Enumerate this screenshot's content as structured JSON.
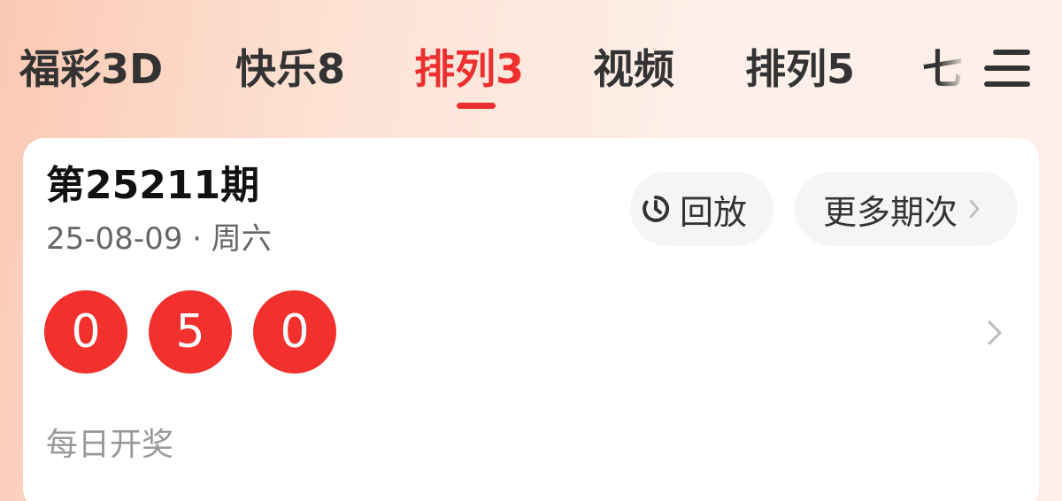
{
  "tabs": [
    {
      "label": "福彩3D"
    },
    {
      "label": "快乐8"
    },
    {
      "label": "排列3"
    },
    {
      "label": "视频"
    },
    {
      "label": "排列5"
    },
    {
      "label": "七"
    }
  ],
  "active_tab": "排列3",
  "draw": {
    "issue": "第25211期",
    "date": "25-08-09 · 周六",
    "numbers": [
      "0",
      "5",
      "0"
    ],
    "schedule": "每日开奖"
  },
  "actions": {
    "replay_label": "回放",
    "more_label": "更多期次"
  },
  "icons": {
    "menu": "menu-icon",
    "replay": "replay-timer-icon",
    "chevron": "chevron-right-icon"
  },
  "colors": {
    "accent": "#ee2f2f",
    "ball": "#f2302e"
  }
}
